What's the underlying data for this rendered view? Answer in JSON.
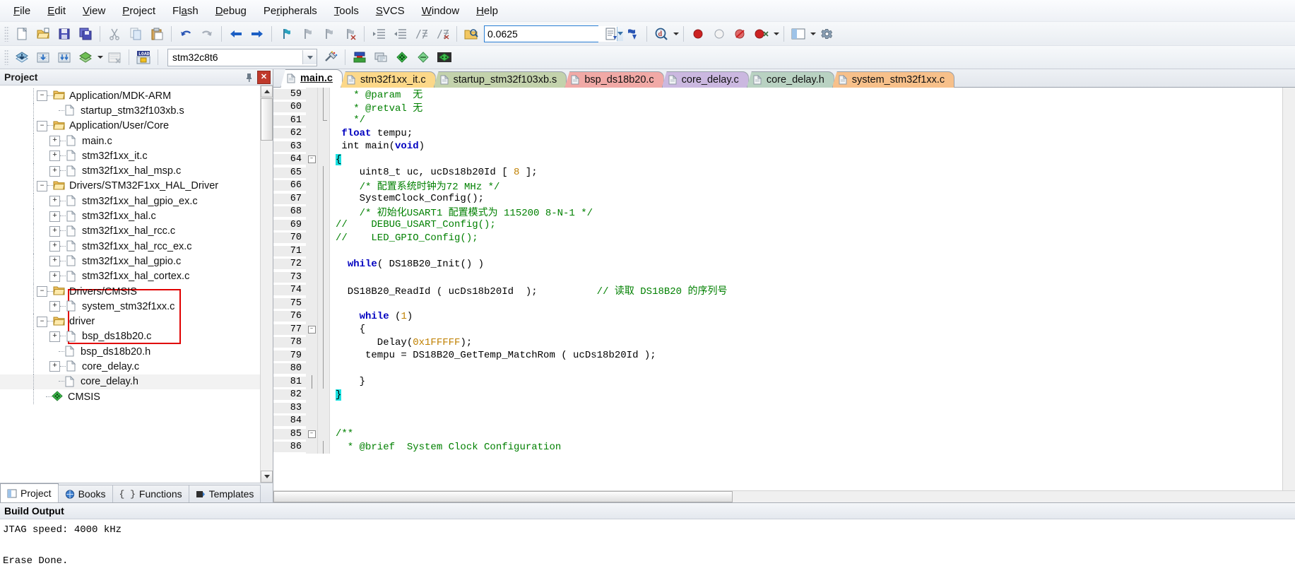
{
  "menu": {
    "items": [
      {
        "label": "File",
        "accel": "F"
      },
      {
        "label": "Edit",
        "accel": "E"
      },
      {
        "label": "View",
        "accel": "V"
      },
      {
        "label": "Project",
        "accel": "P"
      },
      {
        "label": "Flash",
        "accel": "a"
      },
      {
        "label": "Debug",
        "accel": "D"
      },
      {
        "label": "Peripherals",
        "accel": "r"
      },
      {
        "label": "Tools",
        "accel": "T"
      },
      {
        "label": "SVCS",
        "accel": "S"
      },
      {
        "label": "Window",
        "accel": "W"
      },
      {
        "label": "Help",
        "accel": "H"
      }
    ]
  },
  "toolbar1": {
    "buttons": [
      "new-file-icon",
      "open-file-icon",
      "save-icon",
      "save-all-icon",
      "cut-icon",
      "copy-icon",
      "paste-icon",
      "undo-icon",
      "redo-icon",
      "navigate-back-icon",
      "navigate-forward-icon",
      "bookmark-toggle-icon",
      "bookmark-prev-icon",
      "bookmark-next-icon",
      "bookmark-clear-icon",
      "indent-icon",
      "outdent-icon",
      "comment-icon",
      "uncomment-icon",
      "find-in-files-icon"
    ],
    "find_value": "0.0625",
    "find_placeholder": "",
    "after_find": [
      "insert-file-icon",
      "find-next-icon",
      "bookmark-search-icon"
    ],
    "debug_buttons": [
      "start-debug-icon",
      "breakpoint-insert-icon",
      "breakpoint-disable-icon",
      "breakpoint-kill-icon",
      "breakpoint-disable-all-icon"
    ],
    "right_buttons": [
      "window-layout-icon",
      "configure-icon"
    ]
  },
  "toolbar2": {
    "buttons": [
      "translate-icon",
      "build-icon",
      "rebuild-icon",
      "batch-build-icon",
      "stop-build-icon",
      "load-icon"
    ],
    "target_value": "stm32c8t6",
    "after_target": [
      "target-options-icon",
      "manage-runtime-icon",
      "multi-project-icon",
      "books-icon",
      "functions-icon",
      "templates-icon"
    ]
  },
  "project_pane": {
    "title": "Project",
    "pin_icon": "pin-icon",
    "close_icon": "close-icon",
    "tree": [
      {
        "label": "Application/MDK-ARM",
        "type": "folder",
        "toggle": "minus",
        "depth": 0
      },
      {
        "label": "startup_stm32f103xb.s",
        "type": "file",
        "toggle": "none",
        "depth": 1
      },
      {
        "label": "Application/User/Core",
        "type": "folder",
        "toggle": "minus",
        "depth": 0
      },
      {
        "label": "main.c",
        "type": "file",
        "toggle": "plus",
        "depth": 1
      },
      {
        "label": "stm32f1xx_it.c",
        "type": "file",
        "toggle": "plus",
        "depth": 1
      },
      {
        "label": "stm32f1xx_hal_msp.c",
        "type": "file",
        "toggle": "plus",
        "depth": 1
      },
      {
        "label": "Drivers/STM32F1xx_HAL_Driver",
        "type": "folder",
        "toggle": "minus",
        "depth": 0
      },
      {
        "label": "stm32f1xx_hal_gpio_ex.c",
        "type": "file",
        "toggle": "plus",
        "depth": 1
      },
      {
        "label": "stm32f1xx_hal.c",
        "type": "file",
        "toggle": "plus",
        "depth": 1
      },
      {
        "label": "stm32f1xx_hal_rcc.c",
        "type": "file",
        "toggle": "plus",
        "depth": 1
      },
      {
        "label": "stm32f1xx_hal_rcc_ex.c",
        "type": "file",
        "toggle": "plus",
        "depth": 1
      },
      {
        "label": "stm32f1xx_hal_gpio.c",
        "type": "file",
        "toggle": "plus",
        "depth": 1
      },
      {
        "label": "stm32f1xx_hal_cortex.c",
        "type": "file",
        "toggle": "plus",
        "depth": 1
      },
      {
        "label": "Drivers/CMSIS",
        "type": "folder",
        "toggle": "minus",
        "depth": 0
      },
      {
        "label": "system_stm32f1xx.c",
        "type": "file",
        "toggle": "plus",
        "depth": 1
      },
      {
        "label": "driver",
        "type": "folder",
        "toggle": "minus",
        "depth": 0
      },
      {
        "label": "bsp_ds18b20.c",
        "type": "file",
        "toggle": "plus",
        "depth": 1
      },
      {
        "label": "bsp_ds18b20.h",
        "type": "file",
        "toggle": "none",
        "depth": 1
      },
      {
        "label": "core_delay.c",
        "type": "file",
        "toggle": "plus",
        "depth": 1
      },
      {
        "label": "core_delay.h",
        "type": "file",
        "toggle": "none",
        "depth": 1,
        "selected": true
      },
      {
        "label": "CMSIS",
        "type": "cmsis",
        "toggle": "none",
        "depth": 0
      }
    ],
    "annotation_color": "#e00000",
    "tabs": [
      {
        "label": "Project",
        "icon": "project-icon",
        "active": true
      },
      {
        "label": "Books",
        "icon": "books-icon",
        "active": false
      },
      {
        "label": "Functions",
        "icon": "functions-icon",
        "active": false
      },
      {
        "label": "Templates",
        "icon": "templates-icon",
        "active": false
      }
    ]
  },
  "editor": {
    "tabs": [
      {
        "label": "main.c",
        "color": "#c6d4ec",
        "active": true
      },
      {
        "label": "stm32f1xx_it.c",
        "color": "#fcd889",
        "active": false
      },
      {
        "label": "startup_stm32f103xb.s",
        "color": "#c3d2ac",
        "active": false
      },
      {
        "label": "bsp_ds18b20.c",
        "color": "#f1a9a6",
        "active": false
      },
      {
        "label": "core_delay.c",
        "color": "#cbb8e0",
        "active": false
      },
      {
        "label": "core_delay.h",
        "color": "#b9d2c2",
        "active": false
      },
      {
        "label": "system_stm32f1xx.c",
        "color": "#f7c08a",
        "active": false
      }
    ],
    "first_line": 59,
    "lines": [
      {
        "n": 59,
        "fold": "",
        "bar": "v",
        "segs": [
          {
            "t": "   ",
            "c": ""
          },
          {
            "t": "* @param  无",
            "c": "cm"
          }
        ]
      },
      {
        "n": 60,
        "fold": "",
        "bar": "v",
        "segs": [
          {
            "t": "   ",
            "c": ""
          },
          {
            "t": "* @retval 无",
            "c": "cm"
          }
        ]
      },
      {
        "n": 61,
        "fold": "",
        "bar": "vend",
        "segs": [
          {
            "t": "   ",
            "c": ""
          },
          {
            "t": "*/",
            "c": "cm"
          }
        ]
      },
      {
        "n": 62,
        "fold": "",
        "bar": "",
        "segs": [
          {
            "t": " ",
            "c": ""
          },
          {
            "t": "float",
            "c": "kw"
          },
          {
            "t": " tempu;",
            "c": ""
          }
        ]
      },
      {
        "n": 63,
        "fold": "",
        "bar": "",
        "segs": [
          {
            "t": " int main(",
            "c": ""
          },
          {
            "t": "void",
            "c": "kw"
          },
          {
            "t": ")",
            "c": ""
          }
        ]
      },
      {
        "n": 64,
        "fold": "minus",
        "bar": "",
        "segs": [
          {
            "t": "{",
            "c": "hl"
          }
        ]
      },
      {
        "n": 65,
        "fold": "",
        "bar": "v",
        "segs": [
          {
            "t": "    uint8_t uc, ucDs18b20Id [ ",
            "c": ""
          },
          {
            "t": "8",
            "c": "num"
          },
          {
            "t": " ];",
            "c": ""
          }
        ]
      },
      {
        "n": 66,
        "fold": "",
        "bar": "v",
        "segs": [
          {
            "t": "    /* 配置系统时钟为72 MHz */",
            "c": "cm"
          }
        ]
      },
      {
        "n": 67,
        "fold": "",
        "bar": "v",
        "segs": [
          {
            "t": "    SystemClock_Config();",
            "c": ""
          }
        ]
      },
      {
        "n": 68,
        "fold": "",
        "bar": "v",
        "segs": [
          {
            "t": "    /* 初始化USART1 配置模式为 115200 8-N-1 */",
            "c": "cm"
          }
        ]
      },
      {
        "n": 69,
        "fold": "",
        "bar": "v",
        "segs": [
          {
            "t": "//    DEBUG_USART_Config();",
            "c": "cm"
          }
        ]
      },
      {
        "n": 70,
        "fold": "",
        "bar": "v",
        "segs": [
          {
            "t": "//    LED_GPIO_Config();",
            "c": "cm"
          }
        ]
      },
      {
        "n": 71,
        "fold": "",
        "bar": "v",
        "segs": [
          {
            "t": "",
            "c": ""
          }
        ]
      },
      {
        "n": 72,
        "fold": "",
        "bar": "v",
        "segs": [
          {
            "t": "  ",
            "c": ""
          },
          {
            "t": "while",
            "c": "kw"
          },
          {
            "t": "( DS18B20_Init() )",
            "c": ""
          }
        ]
      },
      {
        "n": 73,
        "fold": "",
        "bar": "v",
        "segs": [
          {
            "t": "",
            "c": ""
          }
        ]
      },
      {
        "n": 74,
        "fold": "",
        "bar": "v",
        "segs": [
          {
            "t": "  DS18B20_ReadId ( ucDs18b20Id  );          ",
            "c": ""
          },
          {
            "t": "// 读取 DS18B20 的序列号",
            "c": "cm"
          }
        ]
      },
      {
        "n": 75,
        "fold": "",
        "bar": "v",
        "segs": [
          {
            "t": "",
            "c": ""
          }
        ]
      },
      {
        "n": 76,
        "fold": "",
        "bar": "v",
        "segs": [
          {
            "t": "    ",
            "c": ""
          },
          {
            "t": "while",
            "c": "kw"
          },
          {
            "t": " (",
            "c": ""
          },
          {
            "t": "1",
            "c": "num"
          },
          {
            "t": ")",
            "c": ""
          }
        ]
      },
      {
        "n": 77,
        "fold": "minus",
        "bar": "v",
        "segs": [
          {
            "t": "    {",
            "c": ""
          }
        ]
      },
      {
        "n": 78,
        "fold": "",
        "bar": "v",
        "segs": [
          {
            "t": "       Delay(",
            "c": ""
          },
          {
            "t": "0x1FFFFF",
            "c": "num"
          },
          {
            "t": ");",
            "c": ""
          }
        ]
      },
      {
        "n": 79,
        "fold": "",
        "bar": "v",
        "segs": [
          {
            "t": "     tempu = DS18B20_GetTemp_MatchRom ( ucDs18b20Id );",
            "c": ""
          }
        ]
      },
      {
        "n": 80,
        "fold": "",
        "bar": "v",
        "segs": [
          {
            "t": "",
            "c": ""
          }
        ]
      },
      {
        "n": 81,
        "fold": "end",
        "bar": "v",
        "segs": [
          {
            "t": "    }",
            "c": ""
          }
        ]
      },
      {
        "n": 82,
        "fold": "",
        "bar": "",
        "segs": [
          {
            "t": "}",
            "c": "hl"
          }
        ]
      },
      {
        "n": 83,
        "fold": "",
        "bar": "",
        "segs": [
          {
            "t": "",
            "c": ""
          }
        ]
      },
      {
        "n": 84,
        "fold": "",
        "bar": "",
        "segs": [
          {
            "t": "",
            "c": ""
          }
        ]
      },
      {
        "n": 85,
        "fold": "minus",
        "bar": "",
        "segs": [
          {
            "t": "/**",
            "c": "cm"
          }
        ]
      },
      {
        "n": 86,
        "fold": "",
        "bar": "v",
        "segs": [
          {
            "t": "  * @brief  System Clock Configuration",
            "c": "cm"
          }
        ]
      }
    ]
  },
  "build_output": {
    "title": "Build Output",
    "lines": [
      "JTAG speed: 4000 kHz",
      "",
      "Erase Done."
    ]
  }
}
